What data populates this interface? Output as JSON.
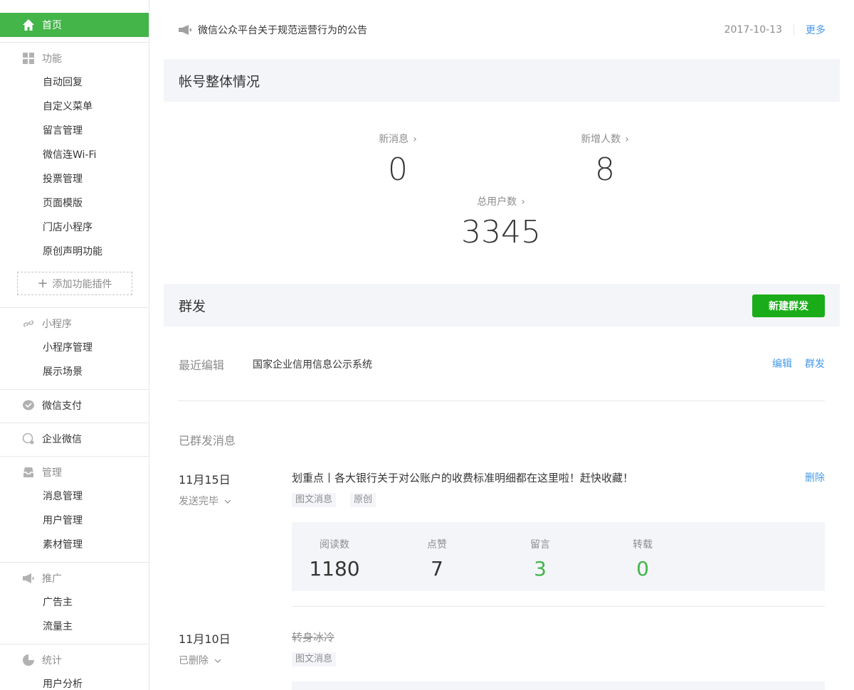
{
  "sidebar": {
    "home": "首页",
    "features": {
      "title": "功能",
      "items": [
        "自动回复",
        "自定义菜单",
        "留言管理",
        "微信连Wi-Fi",
        "投票管理",
        "页面模版",
        "门店小程序",
        "原创声明功能"
      ],
      "add_plugin": "添加功能插件"
    },
    "miniprogram": {
      "title": "小程序",
      "items": [
        "小程序管理",
        "展示场景"
      ]
    },
    "pay": {
      "title": "微信支付"
    },
    "work": {
      "title": "企业微信"
    },
    "manage": {
      "title": "管理",
      "items": [
        "消息管理",
        "用户管理",
        "素材管理"
      ]
    },
    "promote": {
      "title": "推广",
      "items": [
        "广告主",
        "流量主"
      ]
    },
    "stats": {
      "title": "统计",
      "items": [
        "用户分析"
      ]
    }
  },
  "notice": {
    "text": "微信公众平台关于规范运营行为的公告",
    "date": "2017-10-13",
    "more": "更多"
  },
  "overview": {
    "title": "帐号整体情况",
    "new_messages": {
      "label": "新消息",
      "value": "0"
    },
    "new_followers": {
      "label": "新增人数",
      "value": "8"
    },
    "total_users": {
      "label": "总用户数",
      "value": "3345"
    }
  },
  "mass": {
    "title": "群发",
    "new_button": "新建群发",
    "recent_label": "最近编辑",
    "recent_title": "国家企业信用信息公示系统",
    "edit": "编辑",
    "send": "群发",
    "sent_heading": "已群发消息",
    "messages": [
      {
        "date": "11月15日",
        "status": "发送完毕",
        "title": "划重点丨各大银行关于对公账户的收费标准明细都在这里啦！赶快收藏！",
        "tags": [
          "图文消息",
          "原创"
        ],
        "delete": "删除",
        "stats": [
          {
            "label": "阅读数",
            "value": "1180"
          },
          {
            "label": "点赞",
            "value": "7"
          },
          {
            "label": "留言",
            "value": "3"
          },
          {
            "label": "转载",
            "value": "0"
          }
        ]
      },
      {
        "date": "11月10日",
        "status": "已删除",
        "title": "转身冰冷",
        "tags": [
          "图文消息"
        ]
      }
    ]
  },
  "colors": {
    "brand_green": "#44b549",
    "button_green": "#1aad19",
    "link_blue": "#459ae9",
    "panel_gray": "#f4f5f9"
  }
}
